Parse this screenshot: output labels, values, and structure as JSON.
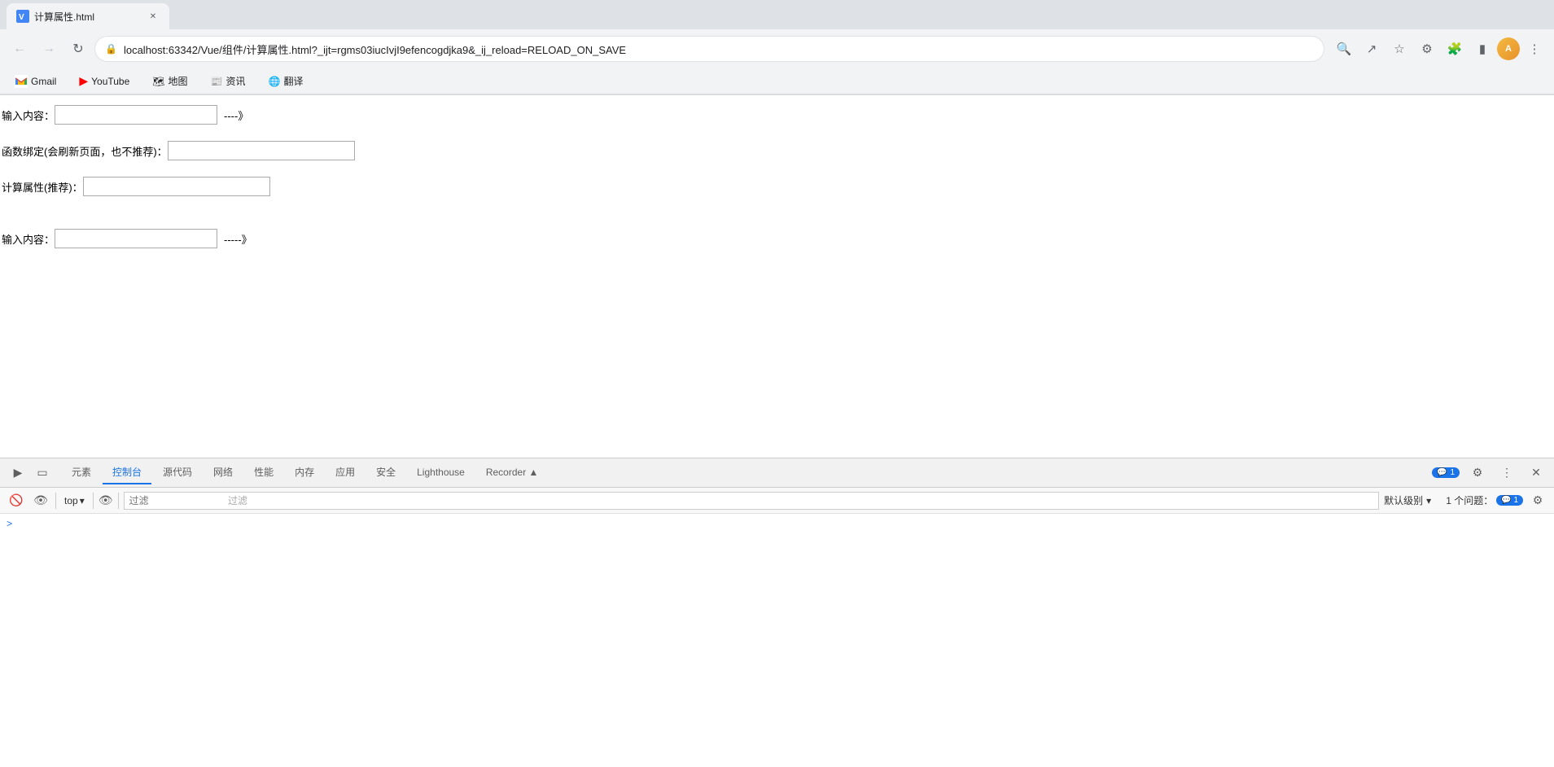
{
  "browser": {
    "url": "localhost:63342/Vue/组件/计算属性.html?_ijt=rgms03iucIvjI9efencogdjka9&_ij_reload=RELOAD_ON_SAVE",
    "tab_title": "计算属性.html"
  },
  "bookmarks": [
    {
      "label": "Gmail",
      "icon": "gmail"
    },
    {
      "label": "YouTube",
      "icon": "youtube"
    },
    {
      "label": "地图",
      "icon": "map"
    },
    {
      "label": "资讯",
      "icon": "news"
    },
    {
      "label": "翻译",
      "icon": "translate"
    }
  ],
  "page": {
    "row1_label": "输入内容：",
    "row1_arrow": "----》",
    "row2_label": "函数绑定(会刷新页面，也不推荐)：",
    "row3_label": "计算属性(推荐)：",
    "row4_label": "输入内容：",
    "row4_arrow": "-----》"
  },
  "devtools": {
    "tabs": [
      {
        "label": "元素",
        "active": false
      },
      {
        "label": "控制台",
        "active": true
      },
      {
        "label": "源代码",
        "active": false
      },
      {
        "label": "网络",
        "active": false
      },
      {
        "label": "性能",
        "active": false
      },
      {
        "label": "内存",
        "active": false
      },
      {
        "label": "应用",
        "active": false
      },
      {
        "label": "安全",
        "active": false
      },
      {
        "label": "Lighthouse",
        "active": false
      },
      {
        "label": "Recorder ▲",
        "active": false
      }
    ],
    "console_badge_count": "1",
    "toolbar": {
      "top_label": "top",
      "filter_placeholder": "过滤",
      "level_label": "默认级别",
      "issues_label": "1 个问题：",
      "issues_count": "1"
    },
    "console_prompt": ">"
  }
}
